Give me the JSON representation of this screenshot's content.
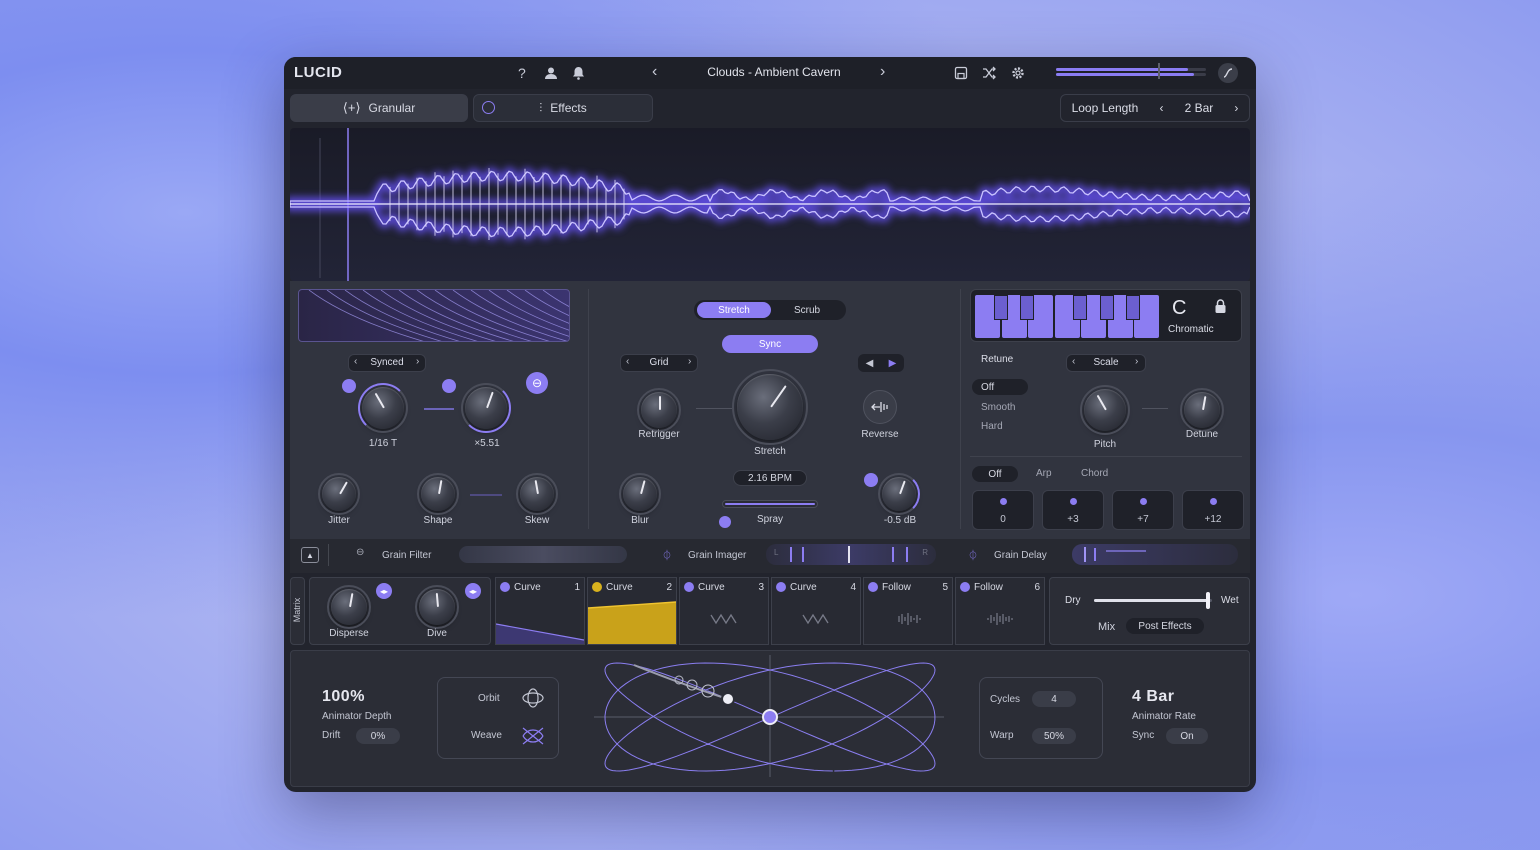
{
  "app": {
    "logo": "LUCID",
    "preset": "Clouds - Ambient Cavern"
  },
  "tabs": {
    "granular": "Granular",
    "effects": "Effects"
  },
  "loop": {
    "label": "Loop Length",
    "value": "2 Bar"
  },
  "grain": {
    "mode": "Synced",
    "rate": "1/16 T",
    "multiplier": "×5.51",
    "jitter": "Jitter",
    "shape": "Shape",
    "skew": "Skew"
  },
  "center": {
    "stretch_tab": "Stretch",
    "scrub_tab": "Scrub",
    "sync": "Sync",
    "grid": "Grid",
    "retrigger": "Retrigger",
    "stretch": "Stretch",
    "reverse": "Reverse",
    "bpm": "2.16 BPM",
    "blur": "Blur",
    "spray": "Spray",
    "gain": "-0.5 dB"
  },
  "pitch": {
    "key": "C",
    "scale_name": "Chromatic",
    "retune": "Retune",
    "scale": "Scale",
    "retune_options": [
      "Off",
      "Smooth",
      "Hard"
    ],
    "pitch": "Pitch",
    "detune": "Detune",
    "modes": [
      "Off",
      "Arp",
      "Chord"
    ],
    "intervals": [
      "0",
      "+3",
      "+7",
      "+12"
    ]
  },
  "fx": {
    "filter": "Grain Filter",
    "imager": "Grain Imager",
    "delay": "Grain Delay",
    "imager_l": "L",
    "imager_r": "R"
  },
  "matrix": {
    "label": "Matrix",
    "disperse": "Disperse",
    "dive": "Dive",
    "slots": [
      {
        "name": "Curve",
        "num": "1"
      },
      {
        "name": "Curve",
        "num": "2"
      },
      {
        "name": "Curve",
        "num": "3"
      },
      {
        "name": "Curve",
        "num": "4"
      },
      {
        "name": "Follow",
        "num": "5"
      },
      {
        "name": "Follow",
        "num": "6"
      }
    ]
  },
  "mix": {
    "dry": "Dry",
    "wet": "Wet",
    "mix": "Mix",
    "post": "Post Effects",
    "level": 0.97
  },
  "animator": {
    "depth": "100%",
    "depth_label": "Animator Depth",
    "drift_label": "Drift",
    "drift": "0%",
    "orbit": "Orbit",
    "weave": "Weave",
    "cycles_label": "Cycles",
    "cycles": "4",
    "warp_label": "Warp",
    "warp": "50%",
    "rate": "4 Bar",
    "rate_label": "Animator Rate",
    "sync_label": "Sync",
    "sync": "On"
  },
  "colors": {
    "accent": "#8c7df2",
    "highlight": "#d9b21e"
  }
}
